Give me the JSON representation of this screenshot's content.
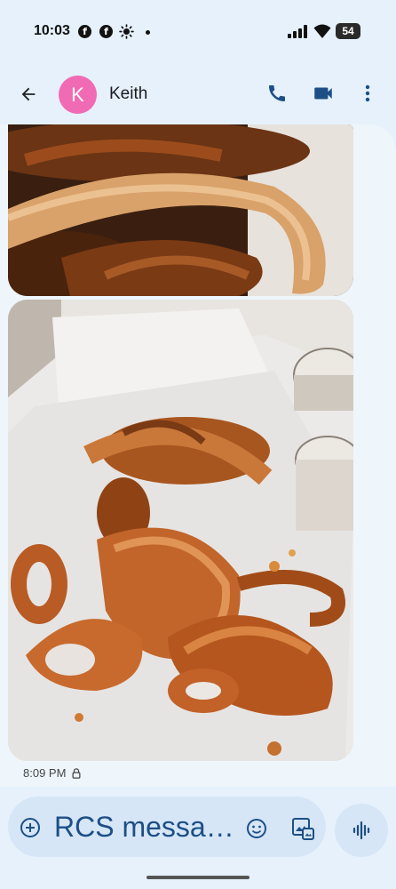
{
  "status_bar": {
    "time": "10:03",
    "battery_level": "54",
    "icons": [
      "facebook-icon",
      "facebook-icon",
      "brightness-icon",
      "dot-icon",
      "signal-icon",
      "wifi-icon",
      "battery-icon"
    ]
  },
  "header": {
    "avatar_letter": "K",
    "contact_name": "Keith",
    "avatar_color": "#f06bb4",
    "icons": [
      "back-arrow-icon",
      "phone-icon",
      "video-call-icon",
      "more-vert-icon"
    ]
  },
  "conversation": {
    "messages": [
      {
        "type": "image",
        "subject": "onion-rings-closeup"
      },
      {
        "type": "image",
        "subject": "onion-rings-on-paper"
      }
    ],
    "timestamp": "8:09 PM"
  },
  "compose": {
    "text": "RCS messa…",
    "icons": [
      "add-circle-icon",
      "emoji-icon",
      "gallery-icon",
      "voice-waveform-icon"
    ]
  },
  "colors": {
    "background": "#e6f1fb",
    "accent": "#1d4f86",
    "compose_bg": "#d6e6f6"
  }
}
